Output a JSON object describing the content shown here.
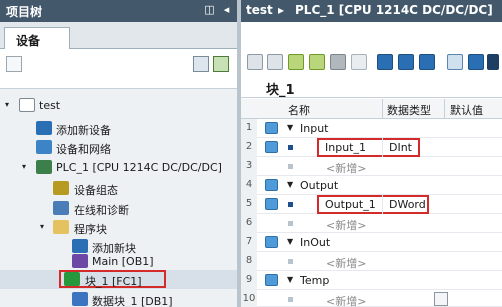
{
  "left": {
    "title": "项目树",
    "header_buttons": [
      "◫",
      "◂"
    ],
    "tab": "设备",
    "tree": [
      {
        "label": "test",
        "arrow": "▾",
        "icon": "document-icon"
      },
      {
        "label": "添加新设备",
        "icon": "add-device-icon"
      },
      {
        "label": "设备和网络",
        "icon": "devices-networks-icon"
      },
      {
        "label": "PLC_1 [CPU 1214C DC/DC/DC]",
        "arrow": "▾",
        "icon": "plc-icon"
      },
      {
        "label": "设备组态",
        "icon": "device-config-icon"
      },
      {
        "label": "在线和诊断",
        "icon": "online-diagnostics-icon"
      },
      {
        "label": "程序块",
        "arrow": "▾",
        "icon": "folder-icon"
      },
      {
        "label": "添加新块",
        "icon": "add-block-icon"
      },
      {
        "label": "Main [OB1]",
        "icon": "ob-block-icon"
      },
      {
        "label": "块_1 [FC1]",
        "icon": "fc-block-icon",
        "selected": true,
        "highlighted": true
      },
      {
        "label": "数据块_1 [DB1]",
        "icon": "db-block-icon"
      }
    ]
  },
  "right": {
    "breadcrumb": [
      "test",
      "PLC_1 [CPU 1214C DC/DC/DC]"
    ],
    "separator": "▸",
    "block_title": "块_1",
    "columns": {
      "name": "名称",
      "type": "数据类型",
      "default": "默认值"
    },
    "rows": [
      {
        "num": "1",
        "kind": "section",
        "name": "Input"
      },
      {
        "num": "2",
        "kind": "param",
        "name": "Input_1",
        "type": "DInt",
        "highlighted": true
      },
      {
        "num": "3",
        "kind": "add",
        "name": "<新增>"
      },
      {
        "num": "4",
        "kind": "section",
        "name": "Output"
      },
      {
        "num": "5",
        "kind": "param",
        "name": "Output_1",
        "type": "DWord",
        "highlighted": true
      },
      {
        "num": "6",
        "kind": "add",
        "name": "<新增>"
      },
      {
        "num": "7",
        "kind": "section",
        "name": "InOut"
      },
      {
        "num": "8",
        "kind": "add",
        "name": "<新增>"
      },
      {
        "num": "9",
        "kind": "section",
        "name": "Temp"
      },
      {
        "num": "10",
        "kind": "add",
        "name": "<新增>",
        "button": true
      }
    ]
  },
  "colors": {
    "header_bg": "#43596b",
    "highlight_border": "#d42a2a",
    "selected_row": "#d7e0e9"
  }
}
